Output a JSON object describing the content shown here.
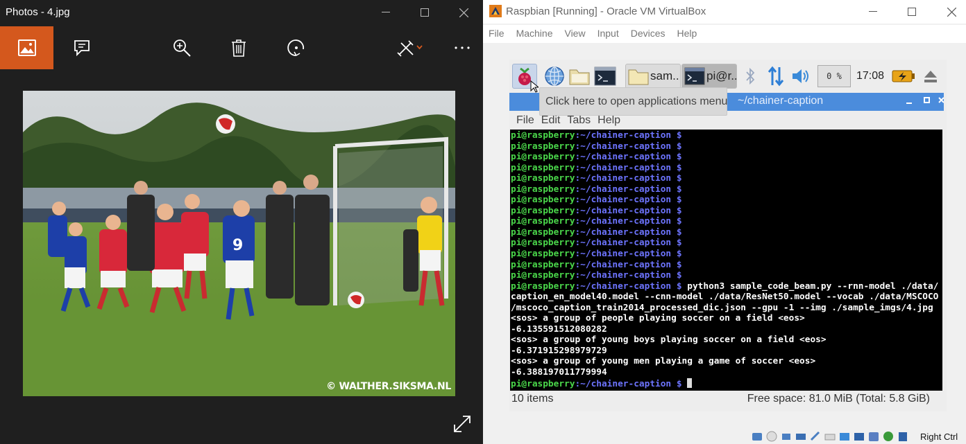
{
  "photos": {
    "title": "Photos - 4.jpg",
    "accent": "#d4581d",
    "toolbar": [
      "view-icon",
      "slideshow-icon",
      "zoom-icon",
      "delete-icon",
      "rotate-icon",
      "edit-icon",
      "more-icon"
    ],
    "watermark": "© WALTHER.SIKSMA.NL"
  },
  "vbox": {
    "title": "Raspbian [Running] - Oracle VM VirtualBox",
    "menu": [
      "File",
      "Machine",
      "View",
      "Input",
      "Devices",
      "Help"
    ],
    "status_right": "Right Ctrl"
  },
  "raspbian": {
    "task1": "sam...",
    "task2": "pi@r...",
    "cpu": "0 %",
    "clock": "17:08",
    "tooltip": "Click here to open applications menu"
  },
  "terminal": {
    "title": "~/chainer-caption",
    "menu": [
      "File",
      "Edit",
      "Tabs",
      "Help"
    ],
    "prompt_user": "pi@raspberry",
    "prompt_path": ":~/chainer-caption $",
    "empty_prompt_count": 14,
    "command": " python3 sample_code_beam.py --rnn-model ./data/",
    "output": [
      "caption_en_model40.model --cnn-model ./data/ResNet50.model --vocab ./data/MSCOCO",
      "/mscoco_caption_train2014_processed_dic.json --gpu -1 --img ./sample_imgs/4.jpg",
      "<sos> a group of people playing soccer on a field <eos>",
      "-6.135591512080282",
      "<sos> a group of young boys playing soccer on a field <eos>",
      "-6.371915298979729",
      "<sos> a group of young men playing a game of soccer <eos>",
      "-6.388197011779994"
    ],
    "status_left": "10 items",
    "status_right": "Free space: 81.0 MiB (Total: 5.8 GiB)"
  }
}
